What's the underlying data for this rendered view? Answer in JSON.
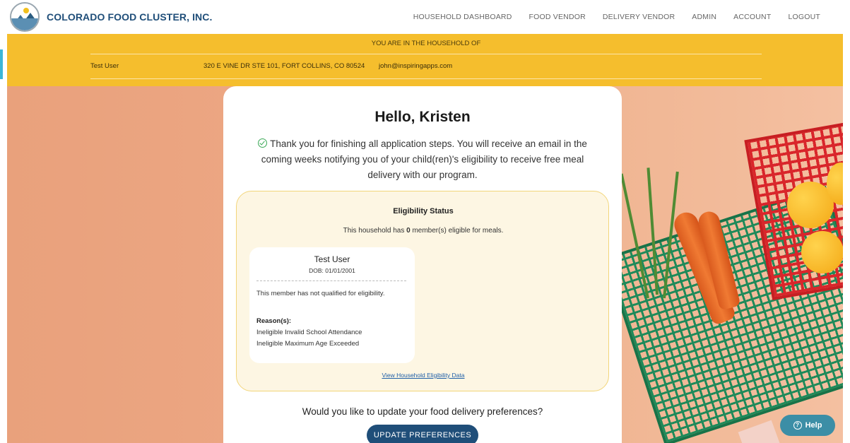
{
  "nav": {
    "brand": "COLORADO FOOD CLUSTER, INC.",
    "links": [
      "HOUSEHOLD DASHBOARD",
      "FOOD VENDOR",
      "DELIVERY VENDOR",
      "ADMIN",
      "ACCOUNT",
      "LOGOUT"
    ]
  },
  "banner": {
    "title": "YOU ARE IN THE HOUSEHOLD OF",
    "name": "Test User",
    "address": "320 E VINE DR STE 101, FORT COLLINS, CO 80524",
    "email": "john@inspiringapps.com"
  },
  "main": {
    "greeting": "Hello, Kristen",
    "message": "Thank you for finishing all application steps. You will receive an email in the coming weeks notifying you of your child(ren)'s eligibility to receive free meal delivery with our program.",
    "eligibility": {
      "title": "Eligibility Status",
      "summary_prefix": "This household has ",
      "eligible_count": "0",
      "summary_suffix": " member(s) eligible for meals.",
      "member": {
        "name": "Test User",
        "dob_label": "DOB:",
        "dob": "01/01/2001",
        "note": "This member has not qualified for eligibility.",
        "reasons_label": "Reason(s):",
        "reasons": [
          "Ineligible Invalid School Attendance",
          "Ineligible Maximum Age Exceeded"
        ]
      },
      "link": "View Household Eligibility Data"
    },
    "question": "Would you like to update your food delivery preferences?",
    "update_button": "UPDATE PREFERENCES"
  },
  "help": {
    "label": "Help",
    "icon": "question-circle-icon"
  },
  "colors": {
    "accent": "#1f4e79",
    "banner": "#f5be2d",
    "help": "#3c8ea6"
  }
}
